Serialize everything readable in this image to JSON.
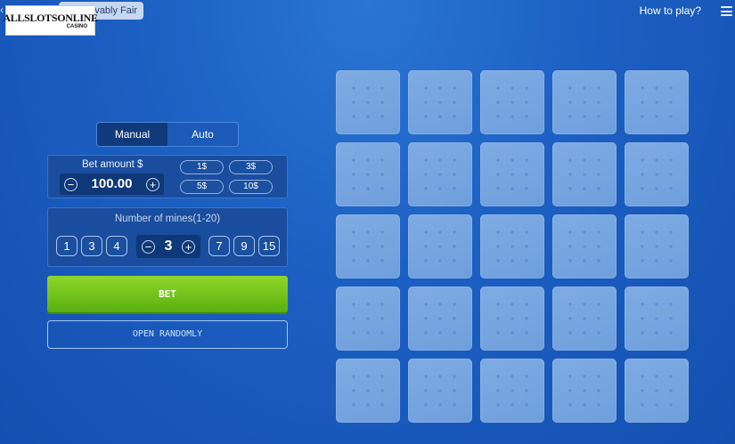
{
  "header": {
    "logo_text": "ALLSLOTSONLINE",
    "logo_sub": "CASINO",
    "provably_fair": "vably Fair",
    "how_to_play": "How to play?"
  },
  "mode": {
    "tabs": [
      "Manual",
      "Auto"
    ],
    "active": "Manual"
  },
  "bet": {
    "label": "Bet amount $",
    "amount": "100.00",
    "minus": "−",
    "plus": "+",
    "chips": [
      "1$",
      "3$",
      "5$",
      "10$"
    ]
  },
  "mines": {
    "label": "Number of mines(1-20)",
    "presets_left": [
      "1",
      "3",
      "4"
    ],
    "value": "3",
    "presets_right": [
      "7",
      "9",
      "15"
    ]
  },
  "actions": {
    "bet": "BET",
    "open_randomly": "OPEN RANDOMLY"
  },
  "board": {
    "rows": 5,
    "cols": 5
  },
  "colors": {
    "accent_green": "#7cc81f",
    "background_blue": "#1c5fc2"
  }
}
